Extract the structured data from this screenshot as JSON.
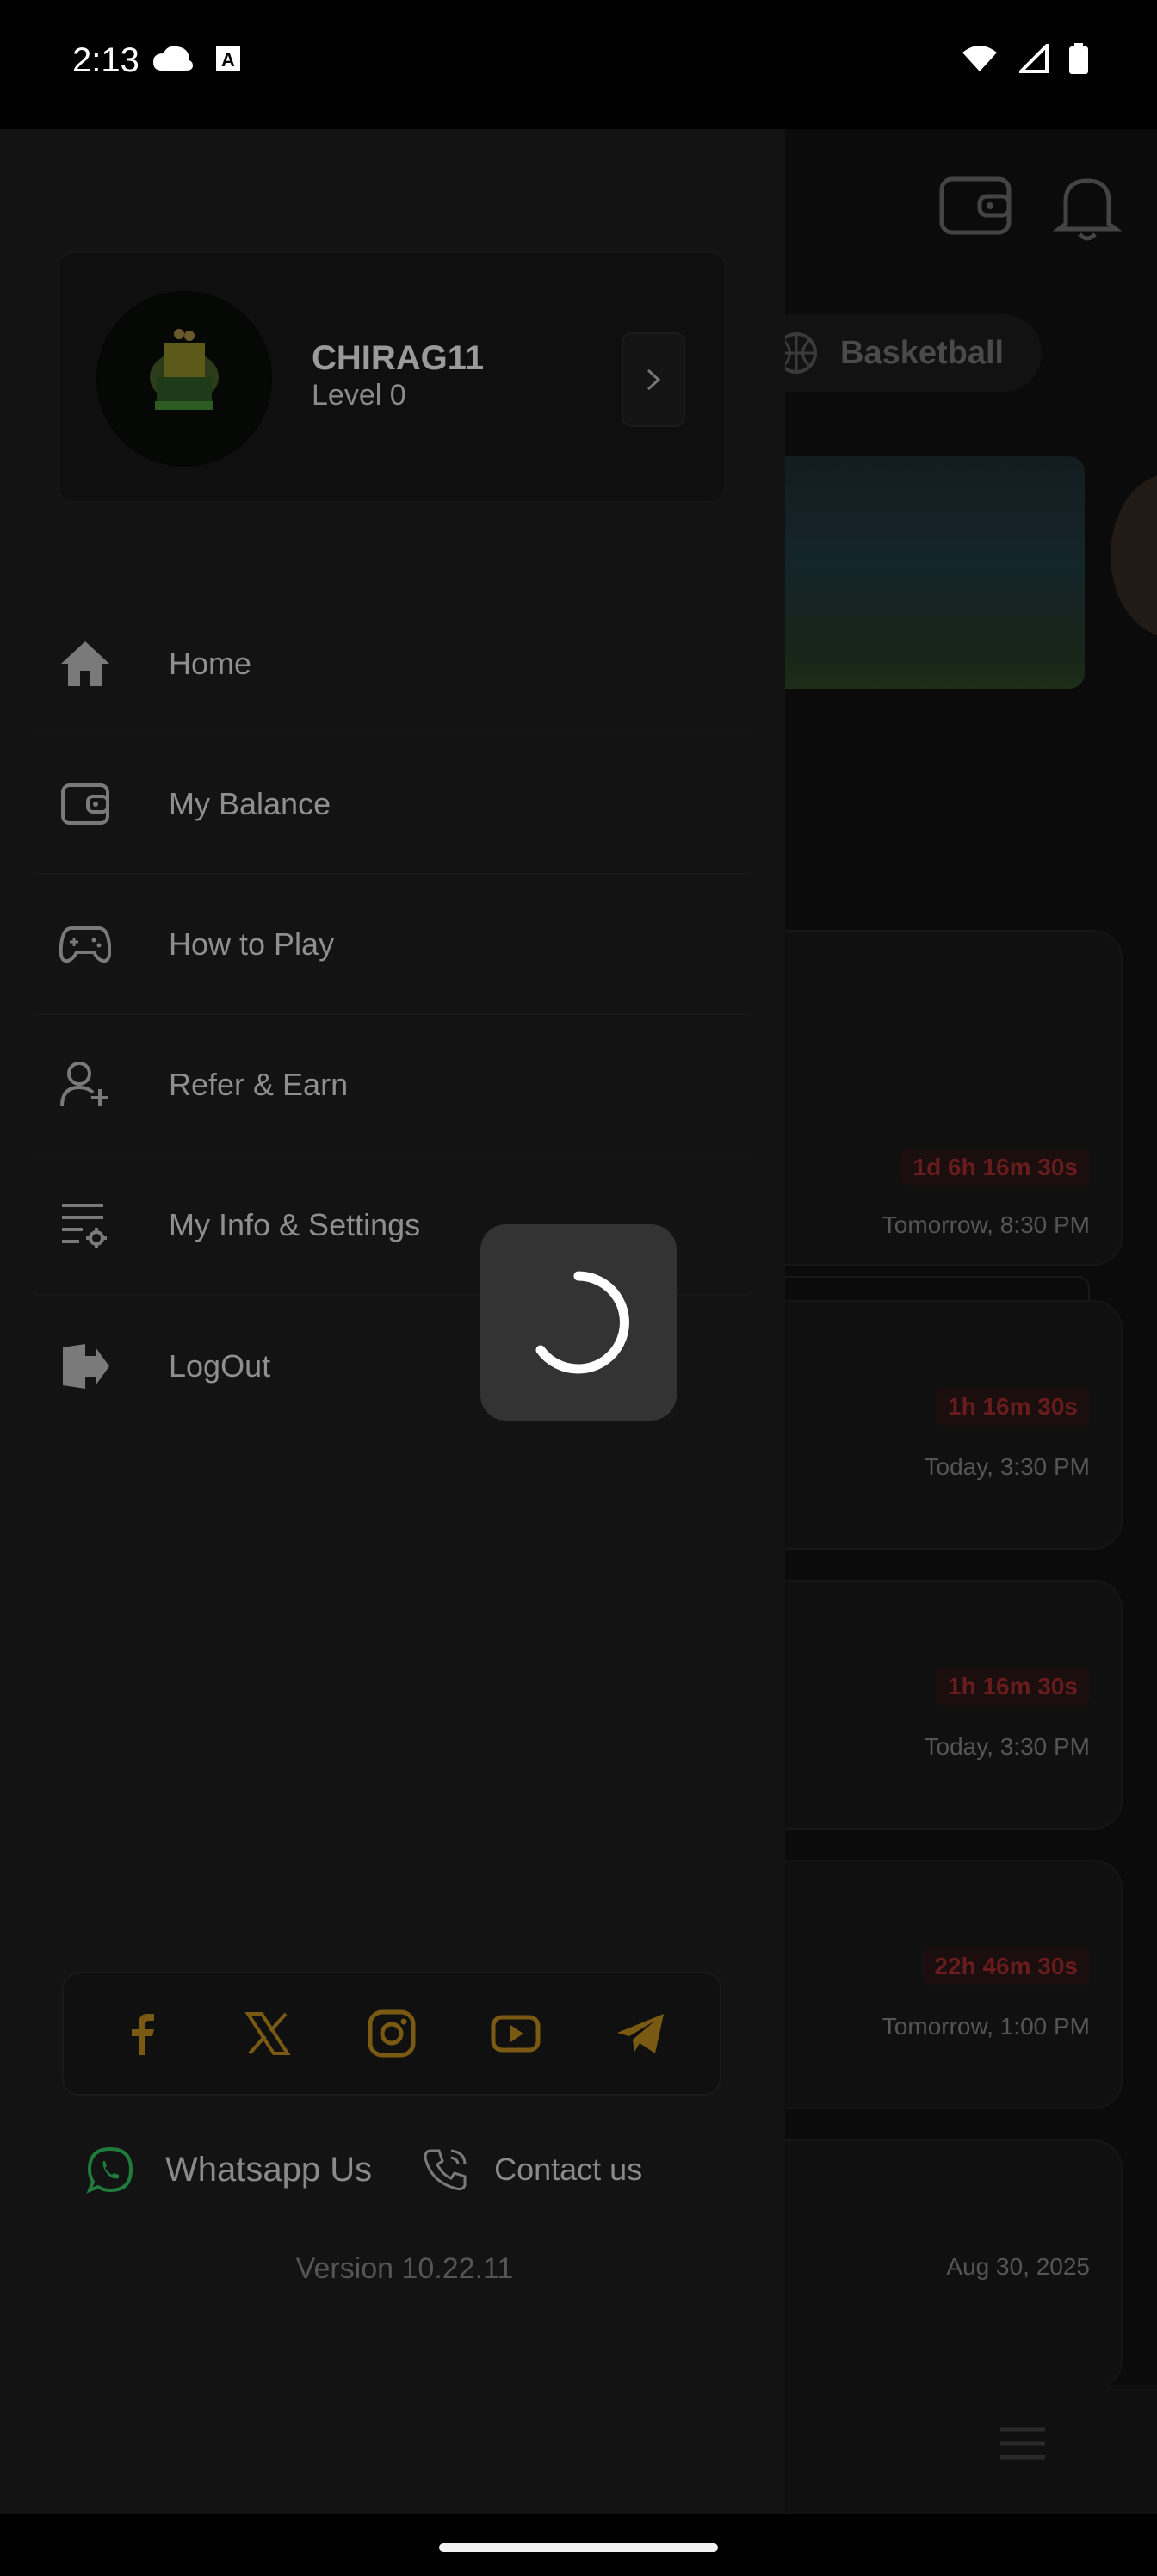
{
  "status_bar": {
    "time": "2:13"
  },
  "background": {
    "tab_label": "Basketball",
    "cards": [
      {
        "timer": "1d 6h 16m 30s",
        "date": "Tomorrow, 8:30 PM"
      },
      {
        "timer": "1h 16m 30s",
        "date": "Today, 3:30 PM"
      },
      {
        "timer": "1h 16m 30s",
        "date": "Today, 3:30 PM"
      },
      {
        "timer": "22h 46m 30s",
        "date": "Tomorrow, 1:00 PM"
      },
      {
        "timer": "",
        "date": "Aug 30, 2025"
      }
    ]
  },
  "profile": {
    "username": "CHIRAG11",
    "level": "Level 0"
  },
  "menu": {
    "items": [
      {
        "label": "Home",
        "icon": "home-icon"
      },
      {
        "label": "My Balance",
        "icon": "wallet-icon"
      },
      {
        "label": "How to Play",
        "icon": "gamepad-icon"
      },
      {
        "label": "Refer & Earn",
        "icon": "user-plus-icon"
      },
      {
        "label": "My Info & Settings",
        "icon": "settings-list-icon"
      },
      {
        "label": "LogOut",
        "icon": "logout-icon"
      }
    ]
  },
  "contact": {
    "whatsapp": "Whatsapp Us",
    "contact_us": "Contact us"
  },
  "version": "Version 10.22.11",
  "colors": {
    "accent_gold": "#7a5a12",
    "whatsapp_green": "#1f7a3c",
    "timer_red": "#6a1c1c"
  }
}
